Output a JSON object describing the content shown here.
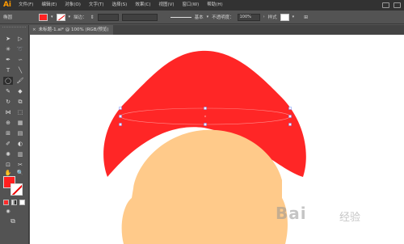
{
  "app": {
    "logo": "Ai"
  },
  "menu": [
    "文件(F)",
    "编辑(E)",
    "对象(O)",
    "文字(T)",
    "选择(S)",
    "效果(C)",
    "视图(V)",
    "窗口(W)",
    "帮助(H)"
  ],
  "control_bar": {
    "selection_label": "椭圆",
    "stroke_label": "描边：",
    "stroke_style_label": "基本",
    "opacity_label": "不透明度：",
    "opacity_value": "100%",
    "style_label": "样式",
    "fill_color": "#ff2222"
  },
  "document_tab": {
    "close_glyph": "×",
    "title": "未标题-1.ai* @ 100% (RGB/预览)"
  },
  "toolbar": {
    "fill_color": "#ff1f1f",
    "stroke": "none"
  },
  "artwork": {
    "mushroom_cap_color": "#ff2626",
    "mushroom_stem_color": "#ffca8a",
    "selected_shape": "ellipse"
  },
  "watermark": {
    "text": "Bai",
    "suffix": "经验"
  }
}
